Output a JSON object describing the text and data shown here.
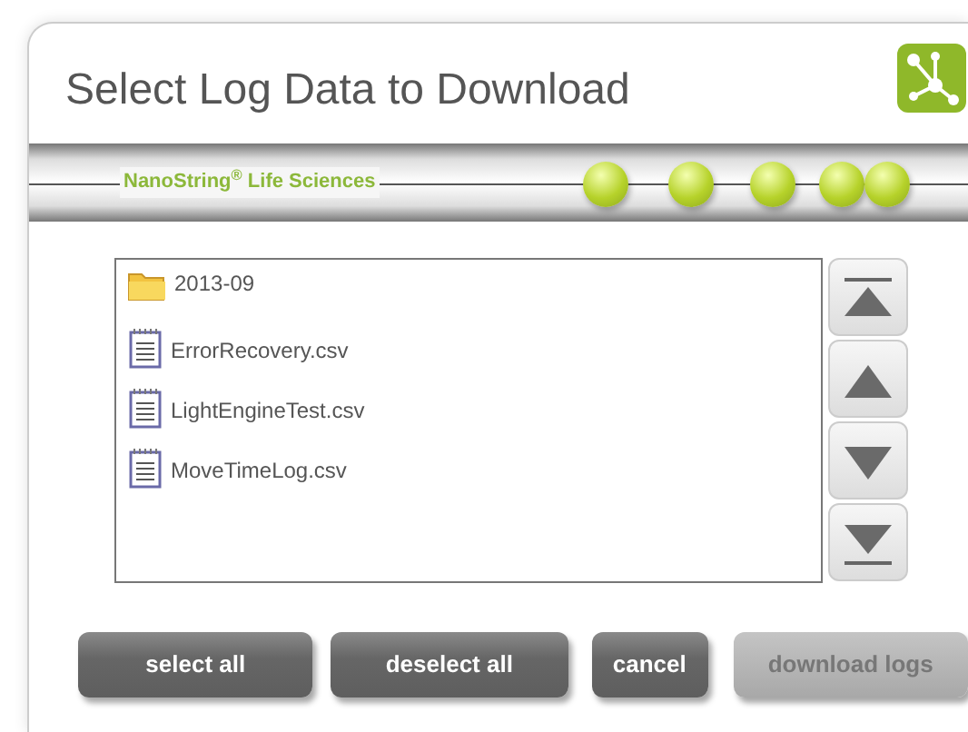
{
  "window": {
    "title": "Select Log Data to Download"
  },
  "brand": {
    "text": "NanoString$^{®}$ Life Sciences"
  },
  "files": [
    {
      "name": "2013-09",
      "kind": "folder",
      "selected": false
    },
    {
      "name": "ErrorRecovery.csv",
      "kind": "file",
      "selected": false
    },
    {
      "name": "LightEngineTest.csv",
      "kind": "file",
      "selected": false
    },
    {
      "name": "MoveTimeLog.csv",
      "kind": "file",
      "selected": false
    }
  ],
  "scroll_buttons": [
    {
      "kind": "top"
    },
    {
      "kind": "up"
    },
    {
      "kind": "down"
    },
    {
      "kind": "bottom"
    }
  ],
  "buttons": [
    {
      "label": "select all",
      "disabled": false
    },
    {
      "label": "deselect all",
      "disabled": false
    },
    {
      "label": "cancel",
      "disabled": false
    },
    {
      "label": "download logs",
      "disabled": true
    }
  ]
}
